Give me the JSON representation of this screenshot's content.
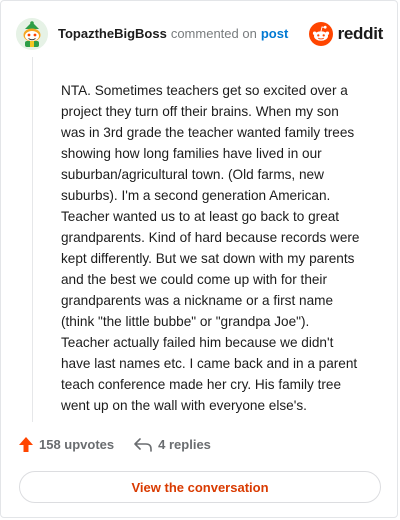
{
  "header": {
    "username": "TopaztheBigBoss",
    "action_text": "commented on",
    "post_link": "post",
    "brand_name": "reddit"
  },
  "comment": {
    "body": "NTA. Sometimes teachers get so excited over a\nproject they turn off their brains. When my son\nwas in 3rd grade the teacher wanted family trees\nshowing how long families have lived in our\nsuburban/agricultural town. (Old farms, new\nsuburbs). I'm a second generation American.\nTeacher wanted us to at least go back to great\ngrandparents. Kind of hard because records were\nkept differently. But we sat down with my parents\nand the best we could come up with for their\ngrandparents was a nickname or a first name\n(think \"the little bubbe\" or \"grandpa Joe\").\nTeacher actually failed him because we didn't\nhave last names etc. I came back and in a parent\nteach conference made her cry. His family tree\nwent up on the wall with everyone else's."
  },
  "actions": {
    "upvotes": "158 upvotes",
    "replies": "4 replies"
  },
  "cta": {
    "label": "View the conversation"
  },
  "colors": {
    "brand": "#ff4500",
    "link": "#0079d3",
    "cta_text": "#d93a00",
    "muted": "#6a6d70",
    "border": "#e3e5e8"
  },
  "icons": {
    "avatar": "snoo-avatar",
    "brand_logo": "reddit-logo-icon",
    "upvote": "upvote-arrow-icon",
    "reply": "reply-arrow-icon"
  }
}
